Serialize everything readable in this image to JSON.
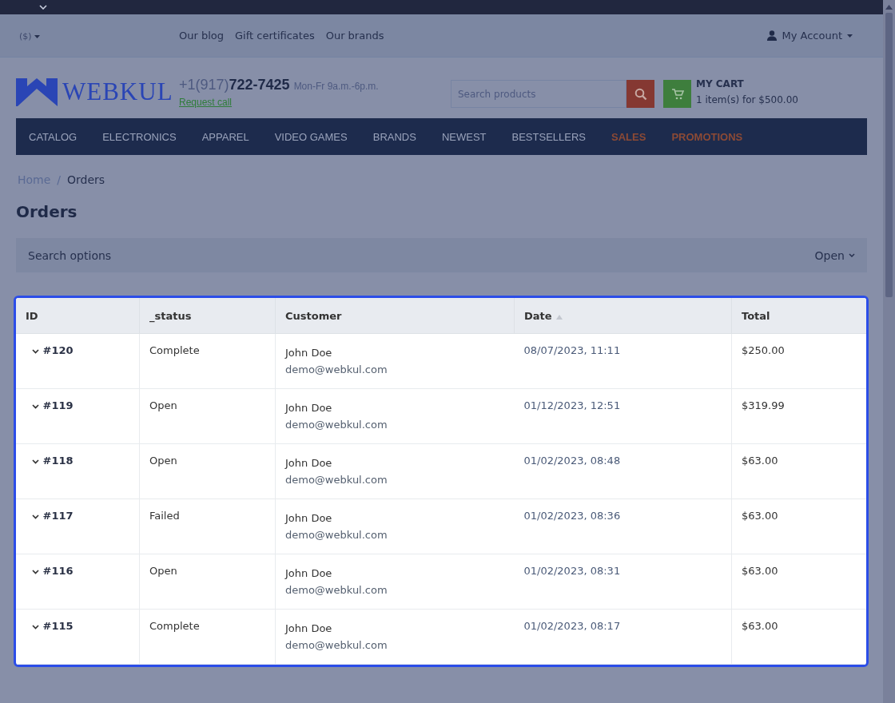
{
  "header": {
    "currency": "($)",
    "links": [
      "Our blog",
      "Gift certificates",
      "Our brands"
    ],
    "account": "My Account",
    "logo": "WEBKUL",
    "phone_prefix": "+1(917)",
    "phone_number": "722-7425",
    "hours": "Mon-Fr 9a.m.-6p.m.",
    "request_call": "Request call",
    "search": {
      "placeholder": "Search products"
    },
    "cart_title": "MY CART",
    "cart_summary": "1 item(s) for $500.00"
  },
  "nav": [
    {
      "label": "CATALOG",
      "kind": "normal"
    },
    {
      "label": "ELECTRONICS",
      "kind": "normal"
    },
    {
      "label": "APPAREL",
      "kind": "normal"
    },
    {
      "label": "VIDEO GAMES",
      "kind": "normal"
    },
    {
      "label": "BRANDS",
      "kind": "normal"
    },
    {
      "label": "NEWEST",
      "kind": "normal"
    },
    {
      "label": "BESTSELLERS",
      "kind": "normal"
    },
    {
      "label": "SALES",
      "kind": "promo"
    },
    {
      "label": "PROMOTIONS",
      "kind": "promo"
    }
  ],
  "breadcrumb": [
    "Home",
    "Orders"
  ],
  "breadcrumb_separator": "/",
  "page_title": "Orders",
  "search_options": {
    "label": "Search options",
    "toggle": "Open"
  },
  "table": {
    "columns": [
      {
        "label": "ID",
        "sorted": false
      },
      {
        "label": "_status",
        "sorted": false
      },
      {
        "label": "Customer",
        "sorted": false
      },
      {
        "label": "Date",
        "sorted": true
      },
      {
        "label": "Total",
        "sorted": false
      }
    ],
    "rows": [
      {
        "id": "#120",
        "status": "Complete",
        "name": "John Doe",
        "email": "demo@webkul.com",
        "date": "08/07/2023, 11:11",
        "total": "$250.00"
      },
      {
        "id": "#119",
        "status": "Open",
        "name": "John Doe",
        "email": "demo@webkul.com",
        "date": "01/12/2023, 12:51",
        "total": "$319.99"
      },
      {
        "id": "#118",
        "status": "Open",
        "name": "John Doe",
        "email": "demo@webkul.com",
        "date": "01/02/2023, 08:48",
        "total": "$63.00"
      },
      {
        "id": "#117",
        "status": "Failed",
        "name": "John Doe",
        "email": "demo@webkul.com",
        "date": "01/02/2023, 08:36",
        "total": "$63.00"
      },
      {
        "id": "#116",
        "status": "Open",
        "name": "John Doe",
        "email": "demo@webkul.com",
        "date": "01/02/2023, 08:31",
        "total": "$63.00"
      },
      {
        "id": "#115",
        "status": "Complete",
        "name": "John Doe",
        "email": "demo@webkul.com",
        "date": "01/02/2023, 08:17",
        "total": "$63.00"
      }
    ]
  }
}
